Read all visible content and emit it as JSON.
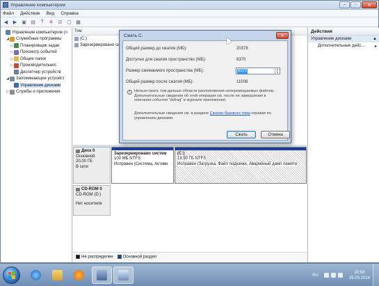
{
  "window": {
    "title": "Управление компьютером"
  },
  "menu": [
    "Файл",
    "Действие",
    "Вид",
    "Справка"
  ],
  "toolbar": {
    "back": "◀",
    "forward": "▶",
    "up": "▣",
    "props": "▤",
    "help": "?",
    "delete": "✕",
    "check": "☑",
    "open": "▢",
    "grid": "▦"
  },
  "tree": {
    "root": "Управление компьютером (л",
    "items": [
      {
        "label": "Служебные программы",
        "level": 1,
        "exp": "◢",
        "icon": "tools"
      },
      {
        "label": "Планировщик задан",
        "level": 2,
        "exp": "▷",
        "icon": "task"
      },
      {
        "label": "Просмотр событий",
        "level": 2,
        "exp": "▷",
        "icon": "event"
      },
      {
        "label": "Общие папки",
        "level": 2,
        "exp": "▷",
        "icon": "folder"
      },
      {
        "label": "Производительнос",
        "level": 2,
        "exp": "▷",
        "icon": "perf"
      },
      {
        "label": "Диспетчер устройств",
        "level": 2,
        "exp": "",
        "icon": "dev"
      },
      {
        "label": "Запоминающие устройст",
        "level": 1,
        "exp": "◢",
        "icon": "store"
      },
      {
        "label": "Управление дисками",
        "level": 2,
        "exp": "",
        "icon": "disk",
        "selected": true
      },
      {
        "label": "Службы и приложения",
        "level": 1,
        "exp": "▷",
        "icon": "svc"
      }
    ]
  },
  "volumes": {
    "header": "Том",
    "rows": [
      "(C:)",
      "Зарезервировано систе"
    ]
  },
  "disks": [
    {
      "name": "Диск 0",
      "type": "Основной",
      "size": "20,00 ГБ",
      "status": "В сети",
      "partitions": [
        {
          "name": "Зарезервировано систем",
          "size": "100 МБ NTFS",
          "status": "Исправен (Система, Активн"
        },
        {
          "name": "(C:)",
          "size": "19,90 ГБ NTFS",
          "status": "Исправен (Загрузка, Файл подкачки, Аварийный дамп памяти"
        }
      ]
    },
    {
      "name": "CD-ROM 0",
      "type": "CD-ROM (D:)",
      "size": "",
      "status": "Нет носителя"
    }
  ],
  "legend": {
    "unallocated": "Не распределен",
    "primary": "Основной раздел"
  },
  "actions": {
    "header": "Действия",
    "section": "Управление дисками",
    "more": "Дополнительные дейс..."
  },
  "dialog": {
    "title": "Сжать C:",
    "total_label": "Общий размер до сжатия (МБ):",
    "total_value": "20378",
    "available_label": "Доступно для сжатия пространство (МБ):",
    "available_value": "8370",
    "shrink_label": "Размер сжимаемого пространства (МБ):",
    "shrink_value": "8370",
    "after_label": "Общий размер после сжатия (МБ):",
    "after_value": "11008",
    "note": "Нельзя сжать том дальше области расположения неперемещаемых файлов. Дополнительные сведения об этой операции см. после ее завершения в описании события \"defrag\" в журнале приложения.",
    "more_info_prefix": "Дополнительные сведения см. в разделе",
    "more_info_link": "Сжатие базового тома",
    "more_info_suffix": "справки по управлению дисками.",
    "ok": "Сжать",
    "cancel": "Отмена"
  },
  "taskbar": {
    "lang": "RU",
    "time": "20:58",
    "date": "25.03.2014"
  },
  "colors": {
    "primary_partition": "#1f3e98",
    "unallocated": "#111111",
    "selection": "#3399ff"
  }
}
